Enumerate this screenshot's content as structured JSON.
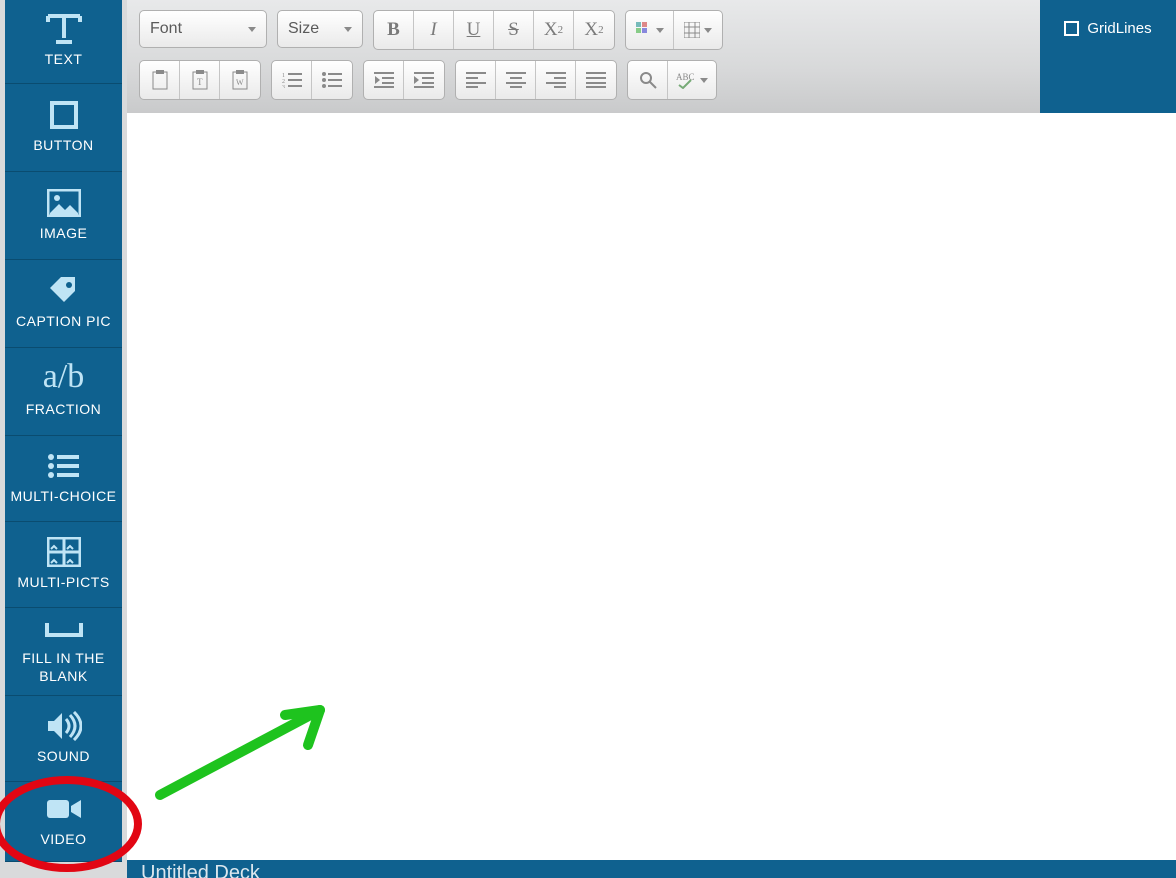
{
  "sidebar": {
    "items": [
      {
        "label": "TEXT"
      },
      {
        "label": "BUTTON"
      },
      {
        "label": "IMAGE"
      },
      {
        "label": "CAPTION PIC"
      },
      {
        "label": "FRACTION",
        "icon_text": "a/b"
      },
      {
        "label": "MULTI-CHOICE"
      },
      {
        "label": "MULTI-PICTS"
      },
      {
        "label": "FILL IN THE BLANK"
      },
      {
        "label": "SOUND"
      },
      {
        "label": "VIDEO"
      }
    ]
  },
  "toolbar": {
    "font_label": "Font",
    "size_label": "Size",
    "bold": "B",
    "italic": "I",
    "underline": "U",
    "strike": "S",
    "subscript_base": "X",
    "subscript_sub": "2",
    "superscript_base": "X",
    "superscript_sup": "2"
  },
  "rightpanel": {
    "gridlines_label": "GridLines"
  },
  "footer": {
    "title": "Untitled Deck"
  }
}
